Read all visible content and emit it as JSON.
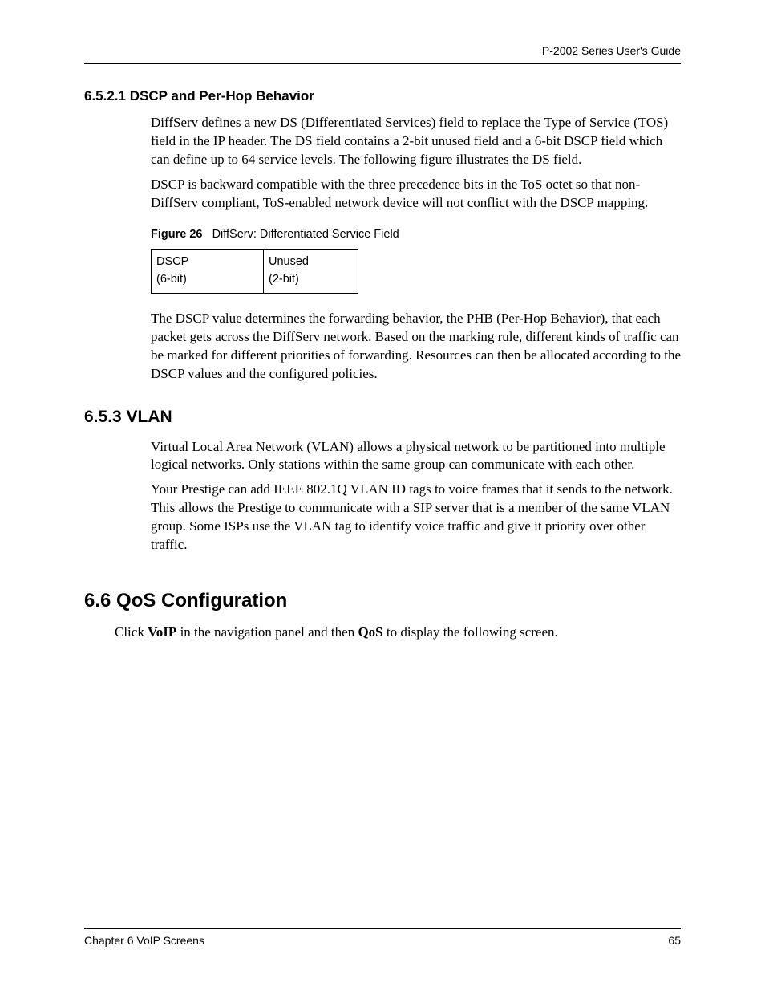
{
  "header": {
    "guide_title": "P-2002 Series User's Guide"
  },
  "section_6521": {
    "heading": "6.5.2.1  DSCP and Per-Hop Behavior",
    "para1": "DiffServ defines a new DS (Differentiated Services) field to replace the Type of Service (TOS) field in the IP header. The DS field contains a 2-bit unused field and a 6-bit DSCP field which can define up to 64 service levels. The following figure illustrates the DS field.",
    "para2": "DSCP is backward compatible with the three precedence bits in the ToS octet so that non-DiffServ compliant, ToS-enabled network device will not conflict with the DSCP mapping.",
    "figure_label": "Figure 26",
    "figure_title": "DiffServ: Differentiated Service Field",
    "table": {
      "col1_line1": "DSCP",
      "col1_line2": "(6-bit)",
      "col2_line1": "Unused",
      "col2_line2": "(2-bit)"
    },
    "para3": "The DSCP value determines the forwarding behavior, the PHB (Per-Hop Behavior), that each packet gets across the DiffServ network.  Based on the marking rule, different kinds of traffic can be marked for different priorities of forwarding. Resources can then be allocated according to the DSCP values and the configured policies."
  },
  "section_653": {
    "heading": "6.5.3  VLAN",
    "para1": "Virtual Local Area Network (VLAN) allows a physical network to be partitioned into multiple logical networks. Only stations within the same group can communicate with each other.",
    "para2": "Your Prestige can add IEEE 802.1Q VLAN ID tags to voice frames that it sends to the network. This allows the Prestige to communicate with a SIP server that is a member of the same VLAN group. Some ISPs use the VLAN tag to identify voice traffic and give it priority over other traffic."
  },
  "section_66": {
    "heading": "6.6  QoS Configuration",
    "para_prefix": "Click ",
    "para_bold1": "VoIP",
    "para_mid": " in the navigation panel and then ",
    "para_bold2": "QoS",
    "para_suffix": " to display the following screen."
  },
  "footer": {
    "chapter": "Chapter 6 VoIP Screens",
    "page": "65"
  }
}
